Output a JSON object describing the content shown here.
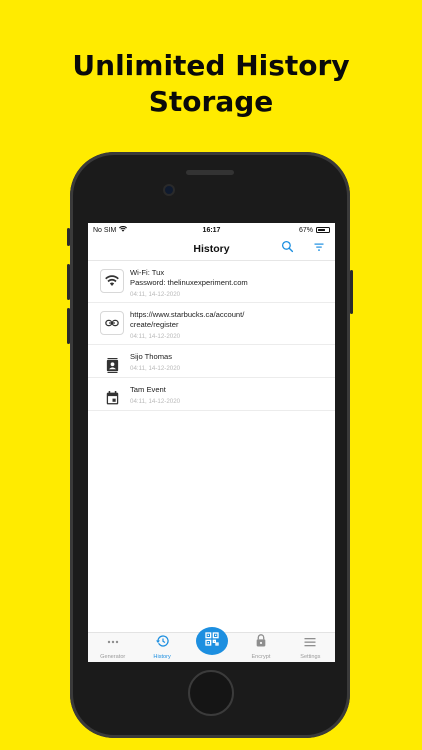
{
  "promo": {
    "headline_line1": "Unlimited History",
    "headline_line2": "Storage"
  },
  "status_bar": {
    "carrier": "No SIM",
    "time": "16:17",
    "battery": "67%",
    "battery_level": 0.67
  },
  "nav": {
    "title": "History"
  },
  "history": [
    {
      "icon": "wifi-icon",
      "title": "Wi-Fi: Tux\nPassword: thelinuxexperiment.com",
      "date": "04:11, 14-12-2020"
    },
    {
      "icon": "link-icon",
      "title": "https://www.starbucks.ca/account/\ncreate/register",
      "date": "04:11, 14-12-2020"
    },
    {
      "icon": "contact-card-icon",
      "title": "Sijo Thomas",
      "date": "04:11, 14-12-2020"
    },
    {
      "icon": "calendar-icon",
      "title": "Tam Event",
      "date": "04:11, 14-12-2020"
    }
  ],
  "tabs": [
    {
      "label": "Generator",
      "icon": "more-dots-icon",
      "active": false
    },
    {
      "label": "History",
      "icon": "history-icon",
      "active": true
    },
    {
      "label": "",
      "icon": "qr-scan-icon",
      "active": false
    },
    {
      "label": "Encrypt",
      "icon": "lock-icon",
      "active": false
    },
    {
      "label": "Settings",
      "icon": "menu-icon",
      "active": false
    }
  ],
  "colors": {
    "background": "#FFEB00",
    "accent": "#1D8FE0"
  }
}
